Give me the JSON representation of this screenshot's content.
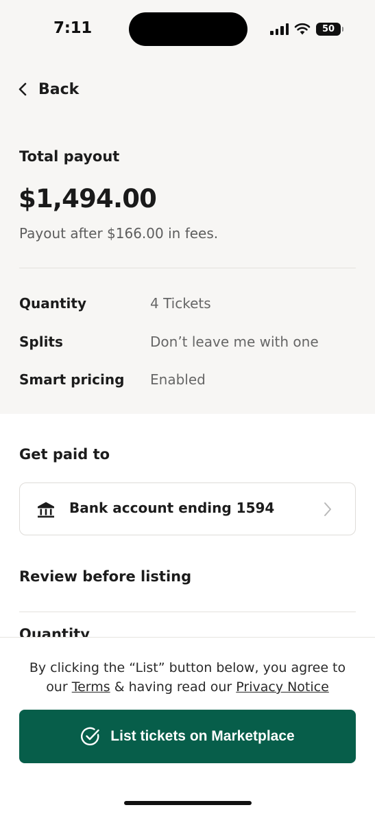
{
  "status_bar": {
    "time": "7:11",
    "battery": "50"
  },
  "nav": {
    "back_label": "Back"
  },
  "payout": {
    "label": "Total payout",
    "amount": "$1,494.00",
    "note": "Payout after $166.00 in fees."
  },
  "details": [
    {
      "key": "Quantity",
      "value": "4 Tickets"
    },
    {
      "key": "Splits",
      "value": "Don’t leave me with one"
    },
    {
      "key": "Smart pricing",
      "value": "Enabled"
    }
  ],
  "get_paid": {
    "heading": "Get paid to",
    "bank_label": "Bank account ending 1594",
    "icon": "bank-icon"
  },
  "review": {
    "heading": "Review before listing",
    "first_item": "Quantity"
  },
  "agreement": {
    "line1": "By clicking the “List” button below, you agree to",
    "prefix": "our ",
    "terms": "Terms",
    "middle": " & having read our ",
    "privacy": "Privacy Notice"
  },
  "cta": {
    "label": "List tickets on Marketplace",
    "color": "#075e4a"
  }
}
